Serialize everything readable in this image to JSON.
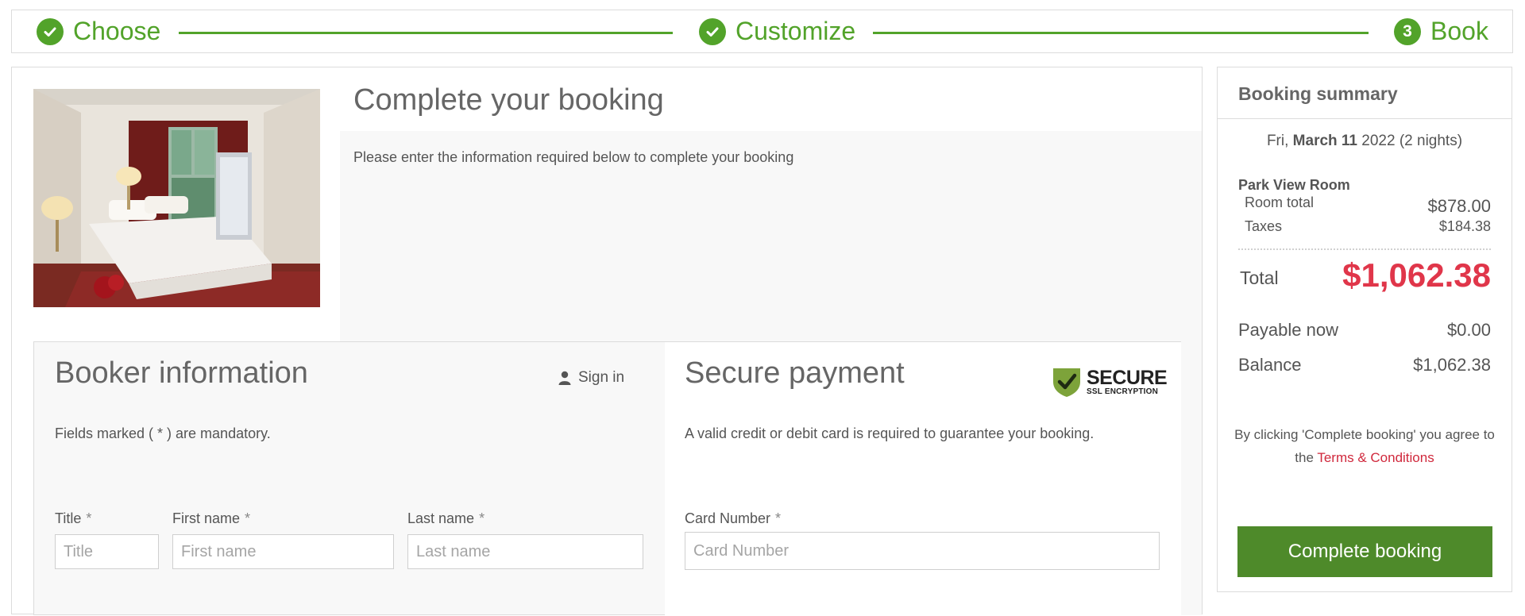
{
  "progress": {
    "steps": [
      {
        "label": "Choose",
        "state": "done"
      },
      {
        "label": "Customize",
        "state": "done"
      },
      {
        "label": "Book",
        "number": "3",
        "state": "current"
      }
    ]
  },
  "main": {
    "title": "Complete your booking",
    "subtitle": "Please enter the information required below to complete your booking"
  },
  "booker": {
    "title": "Booker information",
    "sign_in": "Sign in",
    "mandatory_note": "Fields marked ( * ) are mandatory.",
    "fields": {
      "title": {
        "label": "Title",
        "placeholder": "Title"
      },
      "first_name": {
        "label": "First name",
        "placeholder": "First name"
      },
      "last_name": {
        "label": "Last name",
        "placeholder": "Last name"
      }
    },
    "required_mark": "*"
  },
  "payment": {
    "title": "Secure payment",
    "badge_big": "SECURE",
    "badge_small": "SSL ENCRYPTION",
    "note": "A valid credit or debit card is required to guarantee your booking.",
    "card_number": {
      "label": "Card Number",
      "placeholder": "Card Number"
    }
  },
  "summary": {
    "title": "Booking summary",
    "date_prefix": "Fri,",
    "date_bold": "March 11",
    "date_suffix": "2022 (2 nights)",
    "room_name": "Park View Room",
    "room_total_label": "Room total",
    "room_total_value": "$878.00",
    "taxes_label": "Taxes",
    "taxes_value": "$184.38",
    "total_label": "Total",
    "total_value": "$1,062.38",
    "payable_now_label": "Payable now",
    "payable_now_value": "$0.00",
    "balance_label": "Balance",
    "balance_value": "$1,062.38",
    "agree_text": "By clicking 'Complete booking' you agree to the",
    "terms_link": "Terms & Conditions",
    "button": "Complete booking"
  },
  "colors": {
    "accent_green": "#52a32a",
    "button_green": "#4e8a2a",
    "total_red": "#e0364a"
  }
}
